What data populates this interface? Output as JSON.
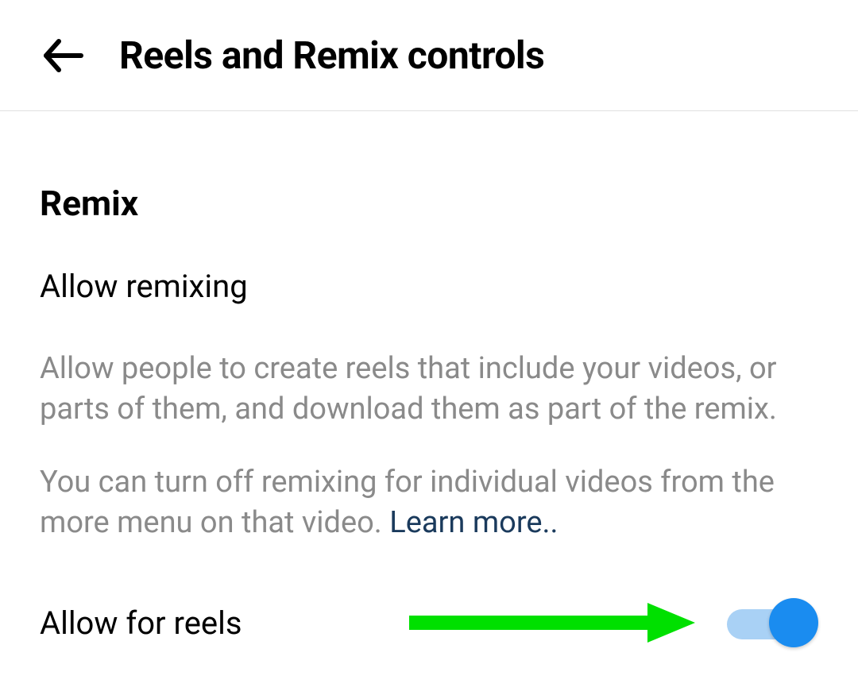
{
  "header": {
    "title": "Reels and Remix controls"
  },
  "section": {
    "title": "Remix",
    "setting_title": "Allow remixing",
    "description_one": "Allow people to create reels that include your videos, or parts of them, and download them as part of the remix.",
    "description_two_prefix": "You can turn off remixing for individual videos from the more menu on that video. ",
    "learn_more": "Learn more.."
  },
  "toggle_row": {
    "label": "Allow for reels",
    "state": "on"
  },
  "colors": {
    "toggle_thumb": "#1a8cf0",
    "toggle_track": "#a9d1f5",
    "annotation_arrow": "#00e000"
  }
}
